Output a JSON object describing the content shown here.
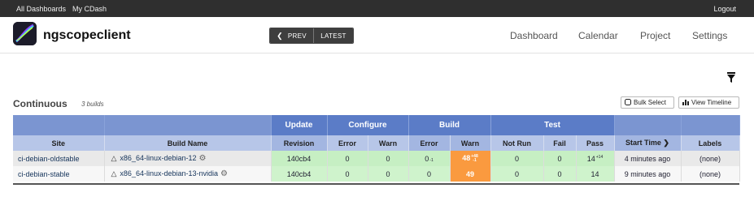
{
  "topbar": {
    "all_dashboards": "All Dashboards",
    "my_cdash": "My CDash",
    "logout": "Logout"
  },
  "header": {
    "project_name": "ngscopeclient",
    "prev_label": "PREV",
    "latest_label": "LATEST",
    "menu": [
      "Dashboard",
      "Calendar",
      "Project",
      "Settings"
    ]
  },
  "section": {
    "title": "Continuous",
    "count": "3 builds",
    "bulk_select": "Bulk Select",
    "view_timeline": "View Timeline"
  },
  "table": {
    "groups": {
      "update": "Update",
      "configure": "Configure",
      "build": "Build",
      "test": "Test"
    },
    "columns": {
      "site": "Site",
      "build_name": "Build Name",
      "revision": "Revision",
      "cfg_error": "Error",
      "cfg_warn": "Warn",
      "build_error": "Error",
      "build_warn": "Warn",
      "not_run": "Not Run",
      "fail": "Fail",
      "pass": "Pass",
      "start_time": "Start Time",
      "labels": "Labels"
    },
    "rows": [
      {
        "site": "ci-debian-oldstable",
        "build_name": "x86_64-linux-debian-12",
        "revision": "140cb4",
        "cfg_error": "0",
        "cfg_warn": "0",
        "build_error": "0",
        "build_error_delta": "-1",
        "build_warn": "48",
        "build_warn_delta_up": "+48",
        "build_warn_delta_down": "-1",
        "not_run": "0",
        "fail": "0",
        "pass": "14",
        "pass_delta": "+14",
        "start_time": "4 minutes ago",
        "labels": "(none)"
      },
      {
        "site": "ci-debian-stable",
        "build_name": "x86_64-linux-debian-13-nvidia",
        "revision": "140cb4",
        "cfg_error": "0",
        "cfg_warn": "0",
        "build_error": "0",
        "build_warn": "49",
        "not_run": "0",
        "fail": "0",
        "pass": "14",
        "start_time": "9 minutes ago",
        "labels": "(none)"
      }
    ]
  },
  "colors": {
    "header_blue": "#5b7cc7",
    "pass_green": "#c6efc3",
    "warn_orange": "#fa9a3f",
    "topbar": "#2f2f2f"
  }
}
